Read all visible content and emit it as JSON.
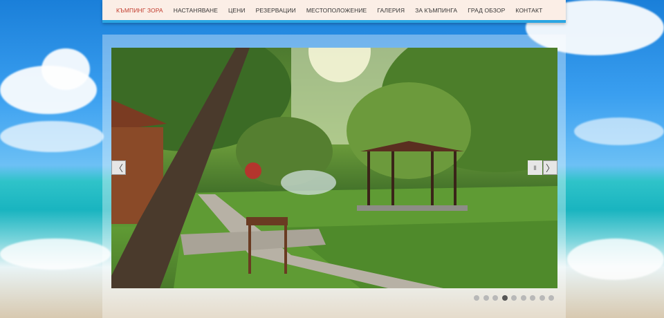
{
  "nav": {
    "brand": "КЪМПИНГ ЗОРА",
    "items": [
      "НАСТАНЯВАНЕ",
      "ЦЕНИ",
      "РЕЗЕРВАЦИИ",
      "МЕСТОПОЛОЖЕНИЕ",
      "ГАЛЕРИЯ",
      "ЗА КЪМПИНГА",
      "ГРАД ОБЗОР",
      "КОНТАКТ"
    ],
    "languages": [
      "en-flag",
      "ru-flag",
      "bg-flag"
    ]
  },
  "slider": {
    "prev_icon": "〈",
    "next_icon": "〉",
    "pause_icon": "ll",
    "slide_count": 9,
    "active_slide": 4
  },
  "colors": {
    "accent": "#2aa6e3",
    "brand": "#c0392b",
    "nav_bg": "#fbeee6"
  }
}
